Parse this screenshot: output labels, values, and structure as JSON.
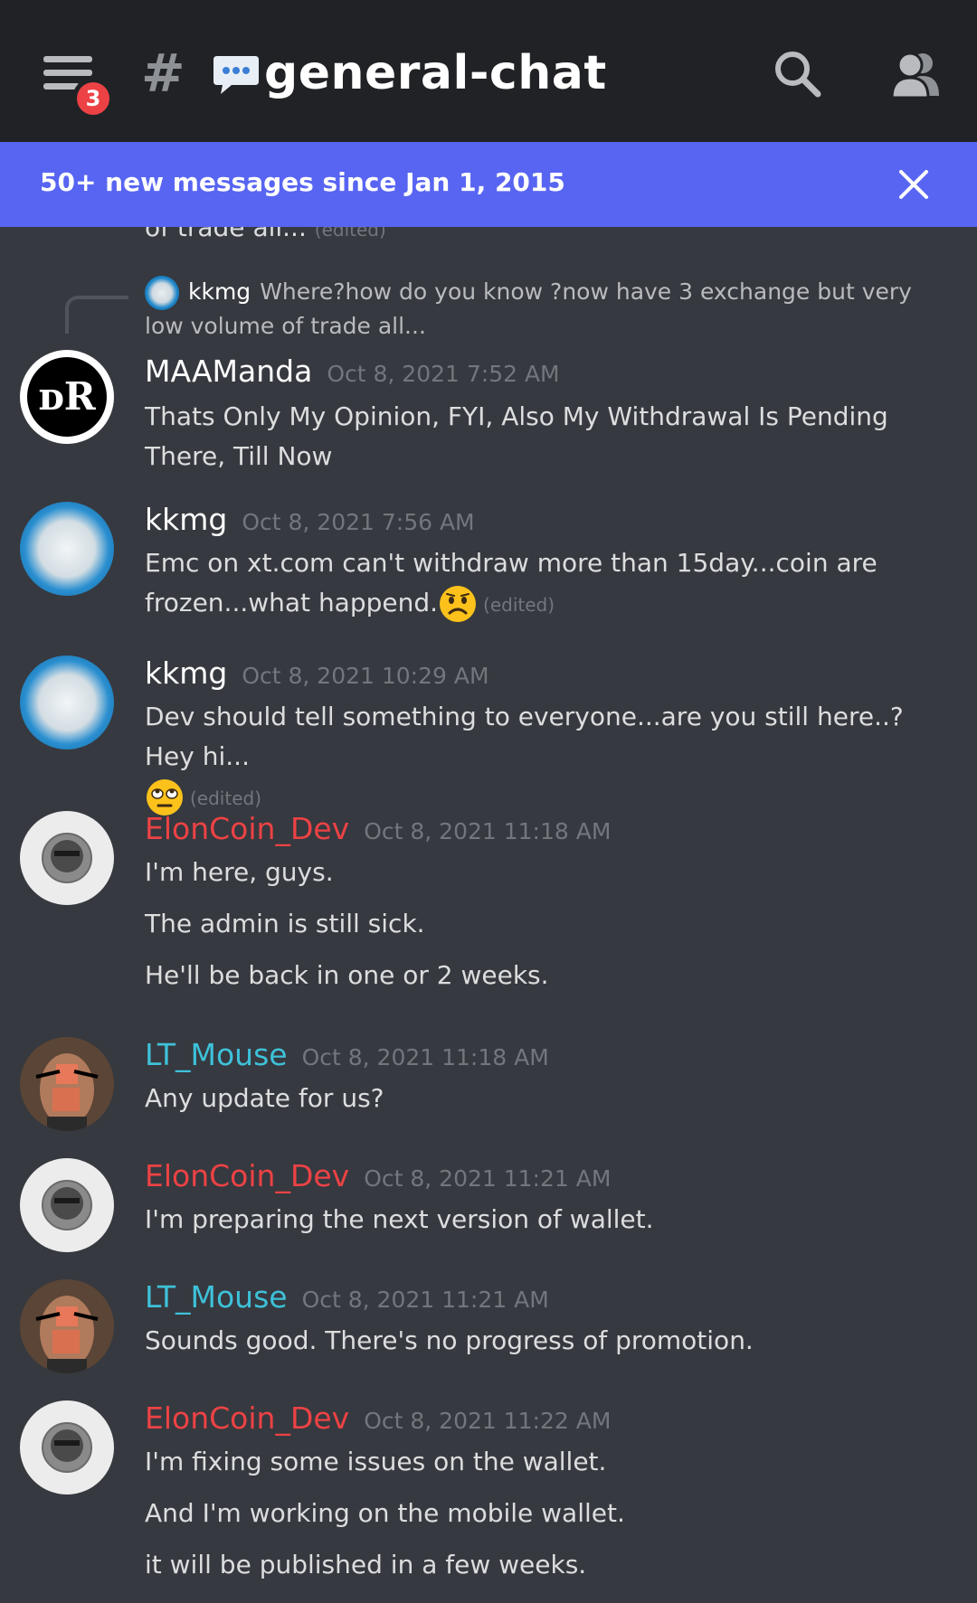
{
  "header": {
    "menu_badge": "3",
    "hash_symbol": "#",
    "channel_name": "general-chat",
    "channel_emoji": "speech-balloon-icon"
  },
  "banner": {
    "text": "50+ new messages since Jan 1, 2015"
  },
  "clipped_message": {
    "text": "of trade all...",
    "edited": "(edited)"
  },
  "reply": {
    "author": "kkmg",
    "text": "Where?how do you know ?now have 3 exchange but very low volume of trade all..."
  },
  "messages": [
    {
      "author": "MAAManda",
      "author_color": "#ffffff",
      "time": "Oct 8, 2021 7:52 AM",
      "avatar_text": "ᴅR",
      "lines": [
        "Thats Only My Opinion, FYI, Also My Withdrawal Is Pending There, Till Now"
      ]
    },
    {
      "author": "kkmg",
      "author_color": "#ffffff",
      "time": "Oct 8, 2021 7:56 AM",
      "lines": [
        "Emc on xt.com can't withdraw more than 15day...coin are frozen...what happend."
      ],
      "edited": "(edited)",
      "emoji": "worried-face-icon"
    },
    {
      "author": "kkmg",
      "author_color": "#ffffff",
      "time": "Oct 8, 2021 10:29 AM",
      "lines": [
        "Dev should tell something to everyone...are you still here..? Hey hi..."
      ],
      "edited": "(edited)",
      "emoji": "rolling-eyes-icon"
    },
    {
      "author": "ElonCoin_Dev",
      "author_color": "#ed4245",
      "time": "Oct 8, 2021 11:18 AM",
      "lines": [
        "I'm here, guys.",
        "The admin is still sick.",
        "He'll be back in one or 2 weeks."
      ]
    },
    {
      "author": "LT_Mouse",
      "author_color": "#3ec1d9",
      "time": "Oct 8, 2021 11:18 AM",
      "lines": [
        "Any update for us?"
      ]
    },
    {
      "author": "ElonCoin_Dev",
      "author_color": "#ed4245",
      "time": "Oct 8, 2021 11:21 AM",
      "lines": [
        "I'm preparing the next version of wallet."
      ]
    },
    {
      "author": "LT_Mouse",
      "author_color": "#3ec1d9",
      "time": "Oct 8, 2021 11:21 AM",
      "lines": [
        "Sounds good. There's no progress of promotion."
      ]
    },
    {
      "author": "ElonCoin_Dev",
      "author_color": "#ed4245",
      "time": "Oct 8, 2021 11:22 AM",
      "lines": [
        "I'm fixing some issues on the wallet.",
        "And I'm working on the mobile wallet.",
        "it will be published in a few weeks."
      ]
    }
  ]
}
